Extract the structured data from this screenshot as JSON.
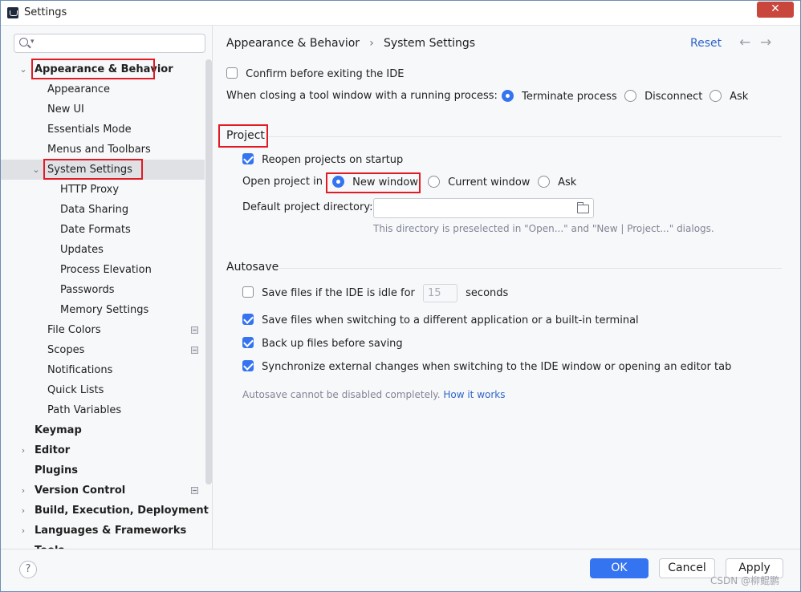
{
  "window": {
    "title": "Settings",
    "close_glyph": "✕"
  },
  "search": {
    "placeholder": ""
  },
  "tree": {
    "appearance_behavior": "Appearance & Behavior",
    "appearance": "Appearance",
    "new_ui": "New UI",
    "essentials_mode": "Essentials Mode",
    "menus_toolbars": "Menus and Toolbars",
    "system_settings": "System Settings",
    "http_proxy": "HTTP Proxy",
    "data_sharing": "Data Sharing",
    "date_formats": "Date Formats",
    "updates": "Updates",
    "process_elevation": "Process Elevation",
    "passwords": "Passwords",
    "memory_settings": "Memory Settings",
    "file_colors": "File Colors",
    "scopes": "Scopes",
    "notifications": "Notifications",
    "quick_lists": "Quick Lists",
    "path_variables": "Path Variables",
    "keymap": "Keymap",
    "editor": "Editor",
    "plugins": "Plugins",
    "version_control": "Version Control",
    "build_execution_deployment": "Build, Execution, Deployment",
    "languages_frameworks": "Languages & Frameworks",
    "tools_partial": "Tools"
  },
  "header": {
    "breadcrumb_parent": "Appearance & Behavior",
    "breadcrumb_sep": "›",
    "breadcrumb_current": "System Settings",
    "reset": "Reset",
    "back_glyph": "←",
    "forward_glyph": "→"
  },
  "general": {
    "confirm_exit": "Confirm before exiting the IDE",
    "confirm_exit_checked": false,
    "closing_tool_window_label": "When closing a tool window with a running process:",
    "closing_options": [
      "Terminate process",
      "Disconnect",
      "Ask"
    ],
    "closing_selected": "Terminate process"
  },
  "project": {
    "title": "Project",
    "reopen": "Reopen projects on startup",
    "reopen_checked": true,
    "open_in_label": "Open project in",
    "open_in_options": [
      "New window",
      "Current window",
      "Ask"
    ],
    "open_in_selected": "New window",
    "default_dir_label": "Default project directory:",
    "default_dir_value": "",
    "default_dir_hint": "This directory is preselected in \"Open...\" and \"New | Project...\" dialogs."
  },
  "autosave": {
    "title": "Autosave",
    "idle_label_before": "Save files if the IDE is idle for",
    "idle_seconds": "15",
    "idle_label_after": "seconds",
    "idle_checked": false,
    "switching": "Save files when switching to a different application or a built-in terminal",
    "switching_checked": true,
    "backup": "Back up files before saving",
    "backup_checked": true,
    "sync": "Synchronize external changes when switching to the IDE window or opening an editor tab",
    "sync_checked": true,
    "note": "Autosave cannot be disabled completely.",
    "note_link": "How it works"
  },
  "footer": {
    "help": "?",
    "ok": "OK",
    "cancel": "Cancel",
    "apply": "Apply",
    "watermark": "CSDN @柳鲲鹏"
  },
  "colors": {
    "accent": "#3574f0",
    "highlight_box": "#e01b24",
    "link": "#2f65ca",
    "selection": "#dfe1e5"
  }
}
